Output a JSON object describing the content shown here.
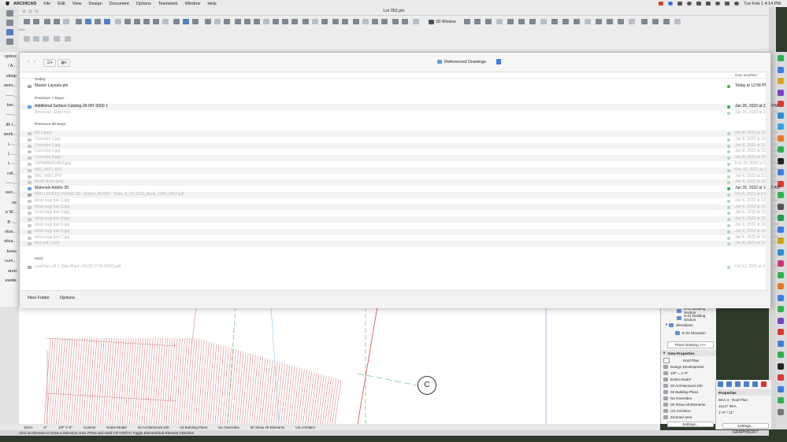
{
  "menubar": {
    "app": "ARCHICAD",
    "items": [
      "File",
      "Edit",
      "View",
      "Design",
      "Document",
      "Options",
      "Teamwork",
      "Window",
      "Help"
    ],
    "clock": "Tue Feb 1  4:14 PM"
  },
  "window": {
    "title": "Lot 352.pln",
    "toolbar_3d_label": "3D Window",
    "toolbar_main_label": "Main"
  },
  "left_fragments": [
    "opbox",
    "/ A...",
    "sktop",
    "wnlo...",
    "-----...",
    "ber...",
    "-----...",
    "ith I...",
    "work...",
    "L -...",
    "L -...",
    "L -...",
    "roll...",
    "-----...",
    "een...",
    "ns",
    "e W...",
    "B -...",
    "otos...",
    "olica...",
    "tures",
    "cum...",
    "ared",
    "ewide"
  ],
  "dialog": {
    "location": "Referenced Drawings",
    "col_date": "Date Modified",
    "sections": {
      "today": "Today",
      "prev7": "Previous 7 Days",
      "prev30": "Previous 30 Days",
      "year": "2021"
    },
    "files_today": [
      {
        "name": "Master Layouts.pln",
        "date": "Today at 12:58 PM",
        "icon": "doc",
        "dim": false
      }
    ],
    "files_prev7": [
      {
        "name": "Additional Surface Catalog-25-INT-3002-1",
        "date": "Jan 26, 2022 at 2:38 PM",
        "icon": "folder",
        "dim": false
      },
      {
        "name": "American_Elder.mov",
        "date": "Jan 26, 2022 at 2:31 PM",
        "icon": "none",
        "dim": true
      }
    ],
    "files_prev30": [
      {
        "name": "Art 1.jpeg",
        "date": "Jan 8, 2022 at 11:33 AM",
        "icon": "img",
        "dim": true
      },
      {
        "name": "Concrete 1.jpg",
        "date": "Jan 8, 2022 at 10:03 AM",
        "icon": "img",
        "dim": true
      },
      {
        "name": "Concrete 2.jpg",
        "date": "Jan 8, 2022 at 10:03 AM",
        "icon": "img",
        "dim": true
      },
      {
        "name": "Concrete 3.jpg",
        "date": "Jan 8, 2022 at 10:03 AM",
        "icon": "img",
        "dim": true
      },
      {
        "name": "Concrete 4.jpg",
        "date": "Jan 8, 2022 at 10:03 AM",
        "icon": "img",
        "dim": true
      },
      {
        "name": "FARMBEACHES.jpg",
        "date": "Feb 10, 2020 at 5:48 PM",
        "icon": "img",
        "dim": true
      },
      {
        "name": "IMG_4371.JPG",
        "date": "Dec 10, 2021 at 1:55 PM",
        "icon": "img",
        "dim": true
      },
      {
        "name": "IMG_5851.JPG",
        "date": "Jan 6, 2022 at 2:22 PM",
        "icon": "img",
        "dim": true
      },
      {
        "name": "Marie Rose.jpeg",
        "date": "Jan 8, 2022 at 12:36 PM",
        "icon": "img",
        "dim": true
      },
      {
        "name": "Materials Adobe 3D",
        "date": "Jan 26, 2022 at 10:47 AM",
        "icon": "folder",
        "dim": false
      },
      {
        "name": "RED LEDGES PHASE 3E - Entry#_467907 - Date_9_13_2019_Book_1064_0962.pdf",
        "date": "Oct 8, 2019 at 9:57 AM",
        "icon": "doc",
        "dim": true
      },
      {
        "name": "show sugi ban 1.jpg",
        "date": "Jan 6, 2022 at 10:39 AM",
        "icon": "img",
        "dim": true
      },
      {
        "name": "show sugi ban 2.jpg",
        "date": "Jan 6, 2022 at 10:40 AM",
        "icon": "img",
        "dim": true
      },
      {
        "name": "show sugi ban 3.jpg",
        "date": "Jan 6, 2022 at 10:40 AM",
        "icon": "img",
        "dim": true
      },
      {
        "name": "show sugi ban 4.jpg",
        "date": "Jan 6, 2022 at 10:40 AM",
        "icon": "img",
        "dim": true
      },
      {
        "name": "show sugi ban 5.jpg",
        "date": "Jan 6, 2022 at 10:41 AM",
        "icon": "img",
        "dim": true
      },
      {
        "name": "show sugi ban 6.jpg",
        "date": "Jan 6, 2022 at 10:42 AM",
        "icon": "img",
        "dim": true
      },
      {
        "name": "show sugi ban 7.jpg",
        "date": "Jan 6, 2022 at 10:43 AM",
        "icon": "img",
        "dim": true
      },
      {
        "name": "test ceb 1.psd",
        "date": "Jan 8, 2022 at 11:57 AM",
        "icon": "img",
        "dim": true
      }
    ],
    "files_year": [
      {
        "name": "LowPlan_#4 1 (Site Plan)--42x30 (7-30-2020).pdf",
        "date": "Oct 11, 2021 at 3:47 PM",
        "icon": "doc",
        "dim": true
      }
    ],
    "new_folder": "New Folder",
    "options": "Options"
  },
  "navigator": {
    "items": [
      {
        "label": "S-01 Building Section",
        "y": 0
      },
      {
        "label": "S-01 Building Section",
        "y": 1
      },
      {
        "label": "Elevations",
        "y": 2
      },
      {
        "label": "E-01 Elevation",
        "y": 3
      }
    ],
    "place_drawing": "Place Drawing >>>",
    "view_properties": "View Properties",
    "roof_plan": "Roof Plan",
    "props": [
      "Design Development",
      "1/8\"    =  1'-0\"",
      "Entire Model",
      "03 Architectural 100",
      "03 Building Plans",
      "No Overrides",
      "00 Show All Elements",
      "US Architect",
      "Zoomed area"
    ],
    "settings": "Settings..."
  },
  "properties": {
    "title": "Properties",
    "rows": [
      "SKA.4 : Roof Plan",
      "11x17 SKA",
      "1'-0\" / 11\""
    ],
    "settings": "Settings..."
  },
  "canvas": {
    "marker": "C"
  },
  "tracker": [
    "151%",
    "0°",
    "1/8\"    1'-0\"",
    "Custom",
    "Entire Model",
    "03 Architectural 100",
    "03 Building Plans",
    "No Overrides",
    "00 Show All Elements",
    "US Architect"
  ],
  "statusbar": "Click an Element or Draw a Selection Area. Press and Hold Ctrl+Shift to Toggle Element/Sub-Element Selection.",
  "brand": "GRAPHISOFT",
  "colors": {
    "accent": "#3a7ee4",
    "folder": "#5aa0e0",
    "green_dot": "#2bb24c"
  }
}
